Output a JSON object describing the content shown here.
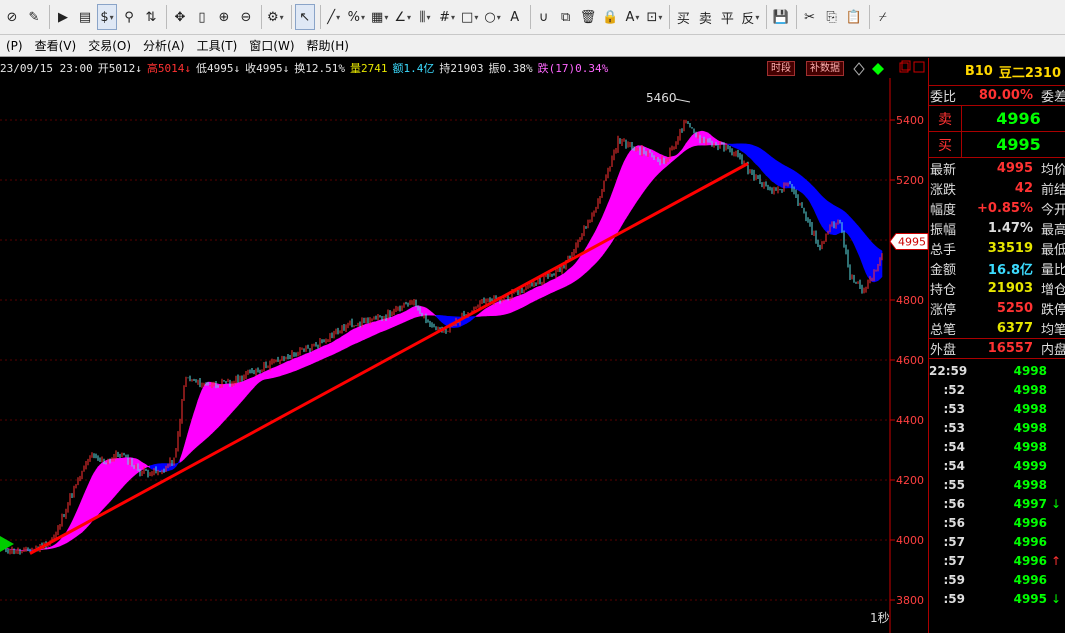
{
  "toolbar": {
    "items": [
      {
        "name": "crosshair-icon",
        "glyph": "⊘"
      },
      {
        "name": "edit-icon",
        "glyph": "✎"
      },
      {
        "sep": true
      },
      {
        "name": "play-icon",
        "glyph": "▶"
      },
      {
        "name": "document-icon",
        "glyph": "▤"
      },
      {
        "name": "dollar-icon",
        "glyph": "$",
        "dd": true,
        "sel": true
      },
      {
        "name": "filter-icon",
        "glyph": "⚲"
      },
      {
        "name": "sort-icon",
        "glyph": "⇅"
      },
      {
        "sep": true
      },
      {
        "name": "move-icon",
        "glyph": "✥"
      },
      {
        "name": "vertical-bar-icon",
        "glyph": "▯"
      },
      {
        "name": "zoom-in-icon",
        "glyph": "⊕"
      },
      {
        "name": "zoom-out-icon",
        "glyph": "⊖"
      },
      {
        "sep": true
      },
      {
        "name": "gear-icon",
        "glyph": "⚙",
        "dd": true
      },
      {
        "sep": true
      },
      {
        "name": "cursor-icon",
        "glyph": "↖",
        "sel": true
      },
      {
        "sep": true
      },
      {
        "name": "line-tool-icon",
        "glyph": "╱",
        "dd": true
      },
      {
        "name": "percent-tool-icon",
        "glyph": "%",
        "dd": true
      },
      {
        "name": "grid-tool-icon",
        "glyph": "▦",
        "dd": true
      },
      {
        "name": "angle-tool-icon",
        "glyph": "∠",
        "dd": true
      },
      {
        "name": "level-tool-icon",
        "glyph": "⫼",
        "dd": true
      },
      {
        "name": "hash-tool-icon",
        "glyph": "#",
        "dd": true
      },
      {
        "name": "rect-tool-icon",
        "glyph": "□",
        "dd": true
      },
      {
        "name": "circle-tool-icon",
        "glyph": "○",
        "dd": true
      },
      {
        "name": "text-tool-icon",
        "glyph": "A"
      },
      {
        "sep": true
      },
      {
        "name": "magnet-icon",
        "glyph": "∪"
      },
      {
        "name": "copy-layer-icon",
        "glyph": "⧉"
      },
      {
        "name": "delete-icon",
        "glyph": "🗑"
      },
      {
        "name": "lock-icon",
        "glyph": "🔒"
      },
      {
        "name": "color-text-icon",
        "glyph": "A",
        "dd": true
      },
      {
        "name": "save-box-icon",
        "glyph": "⊡",
        "dd": true
      },
      {
        "sep": true
      },
      {
        "name": "buy-button",
        "glyph": "买",
        "txt": true
      },
      {
        "name": "sell-button",
        "glyph": "卖",
        "txt": true
      },
      {
        "name": "close-position-button",
        "glyph": "平",
        "txt": true
      },
      {
        "name": "reverse-button",
        "glyph": "反",
        "txt": true,
        "dd": true
      },
      {
        "sep": true
      },
      {
        "name": "save-icon",
        "glyph": "💾"
      },
      {
        "sep": true
      },
      {
        "name": "cut-icon",
        "glyph": "✂"
      },
      {
        "name": "copy-icon",
        "glyph": "⎘"
      },
      {
        "name": "paste-icon",
        "glyph": "📋"
      },
      {
        "sep": true
      },
      {
        "name": "brush-icon",
        "glyph": "⌿"
      }
    ]
  },
  "menu": [
    "(P)",
    "查看(V)",
    "交易(O)",
    "分析(A)",
    "工具(T)",
    "窗口(W)",
    "帮助(H)"
  ],
  "info": [
    {
      "t": "23/09/15 23:00",
      "c": "white"
    },
    {
      "t": "开5012↓",
      "c": "white"
    },
    {
      "t": "高5014↓",
      "c": "red"
    },
    {
      "t": "低4995↓",
      "c": "white"
    },
    {
      "t": "收4995↓",
      "c": "white"
    },
    {
      "t": "换12.51%",
      "c": "white"
    },
    {
      "t": "量2741",
      "c": "yellow"
    },
    {
      "t": "额1.4亿",
      "c": "cyan"
    },
    {
      "t": "持21903",
      "c": "white"
    },
    {
      "t": "振0.38%",
      "c": "white"
    },
    {
      "t": "跌(17)0.34%",
      "c": "pink"
    }
  ],
  "mini_buttons": [
    "时段",
    "补数据"
  ],
  "chart": {
    "yticks": [
      3800,
      4000,
      4200,
      4400,
      4600,
      4800,
      5000,
      5200,
      5400
    ],
    "high_label": "5460",
    "price_tag": "4995",
    "period": "1秒",
    "colors": {
      "bull": "#ff3232",
      "bear": "#5ce1e6",
      "band_up": "#ff00ff",
      "band_down": "#0000ff",
      "trend": "#ff0000"
    }
  },
  "panel": {
    "code": "B10",
    "name": "豆二2310",
    "weibi": {
      "label": "委比",
      "value": "80.00%",
      "label2": "委差"
    },
    "sell": {
      "label": "卖",
      "value": "4996"
    },
    "buy": {
      "label": "买",
      "value": "4995"
    },
    "rows": [
      {
        "label": "最新",
        "value": "4995",
        "color": "#ff3232",
        "label2": "均价"
      },
      {
        "label": "涨跌",
        "value": "42",
        "color": "#ff3232",
        "label2": "前结"
      },
      {
        "label": "幅度",
        "value": "+0.85%",
        "color": "#ff3232",
        "label2": "今开"
      },
      {
        "label": "振幅",
        "value": "1.47%",
        "color": "#dddddd",
        "label2": "最高"
      },
      {
        "label": "总手",
        "value": "33519",
        "color": "#e6e600",
        "label2": "最低"
      },
      {
        "label": "金额",
        "value": "16.8亿",
        "color": "#3cdcff",
        "label2": "量比"
      },
      {
        "label": "持仓",
        "value": "21903",
        "color": "#e6e600",
        "label2": "增仓"
      },
      {
        "label": "涨停",
        "value": "5250",
        "color": "#ff3232",
        "label2": "跌停"
      },
      {
        "label": "总笔",
        "value": "6377",
        "color": "#e6e600",
        "label2": "均笔"
      }
    ],
    "outer": {
      "label": "外盘",
      "value": "16557",
      "color": "#ff3232",
      "label2": "内盘"
    },
    "ticks": [
      {
        "time": "22:59",
        "price": "4998",
        "arrow": ""
      },
      {
        "time": ":52",
        "price": "4998",
        "arrow": ""
      },
      {
        "time": ":53",
        "price": "4998",
        "arrow": ""
      },
      {
        "time": ":53",
        "price": "4998",
        "arrow": ""
      },
      {
        "time": ":54",
        "price": "4998",
        "arrow": ""
      },
      {
        "time": ":54",
        "price": "4999",
        "arrow": ""
      },
      {
        "time": ":55",
        "price": "4998",
        "arrow": ""
      },
      {
        "time": ":56",
        "price": "4997",
        "arrow": "↓"
      },
      {
        "time": ":56",
        "price": "4996",
        "arrow": ""
      },
      {
        "time": ":57",
        "price": "4996",
        "arrow": ""
      },
      {
        "time": ":57",
        "price": "4996",
        "arrow": "↑"
      },
      {
        "time": ":59",
        "price": "4996",
        "arrow": ""
      },
      {
        "time": ":59",
        "price": "4995",
        "arrow": "↓"
      }
    ]
  }
}
